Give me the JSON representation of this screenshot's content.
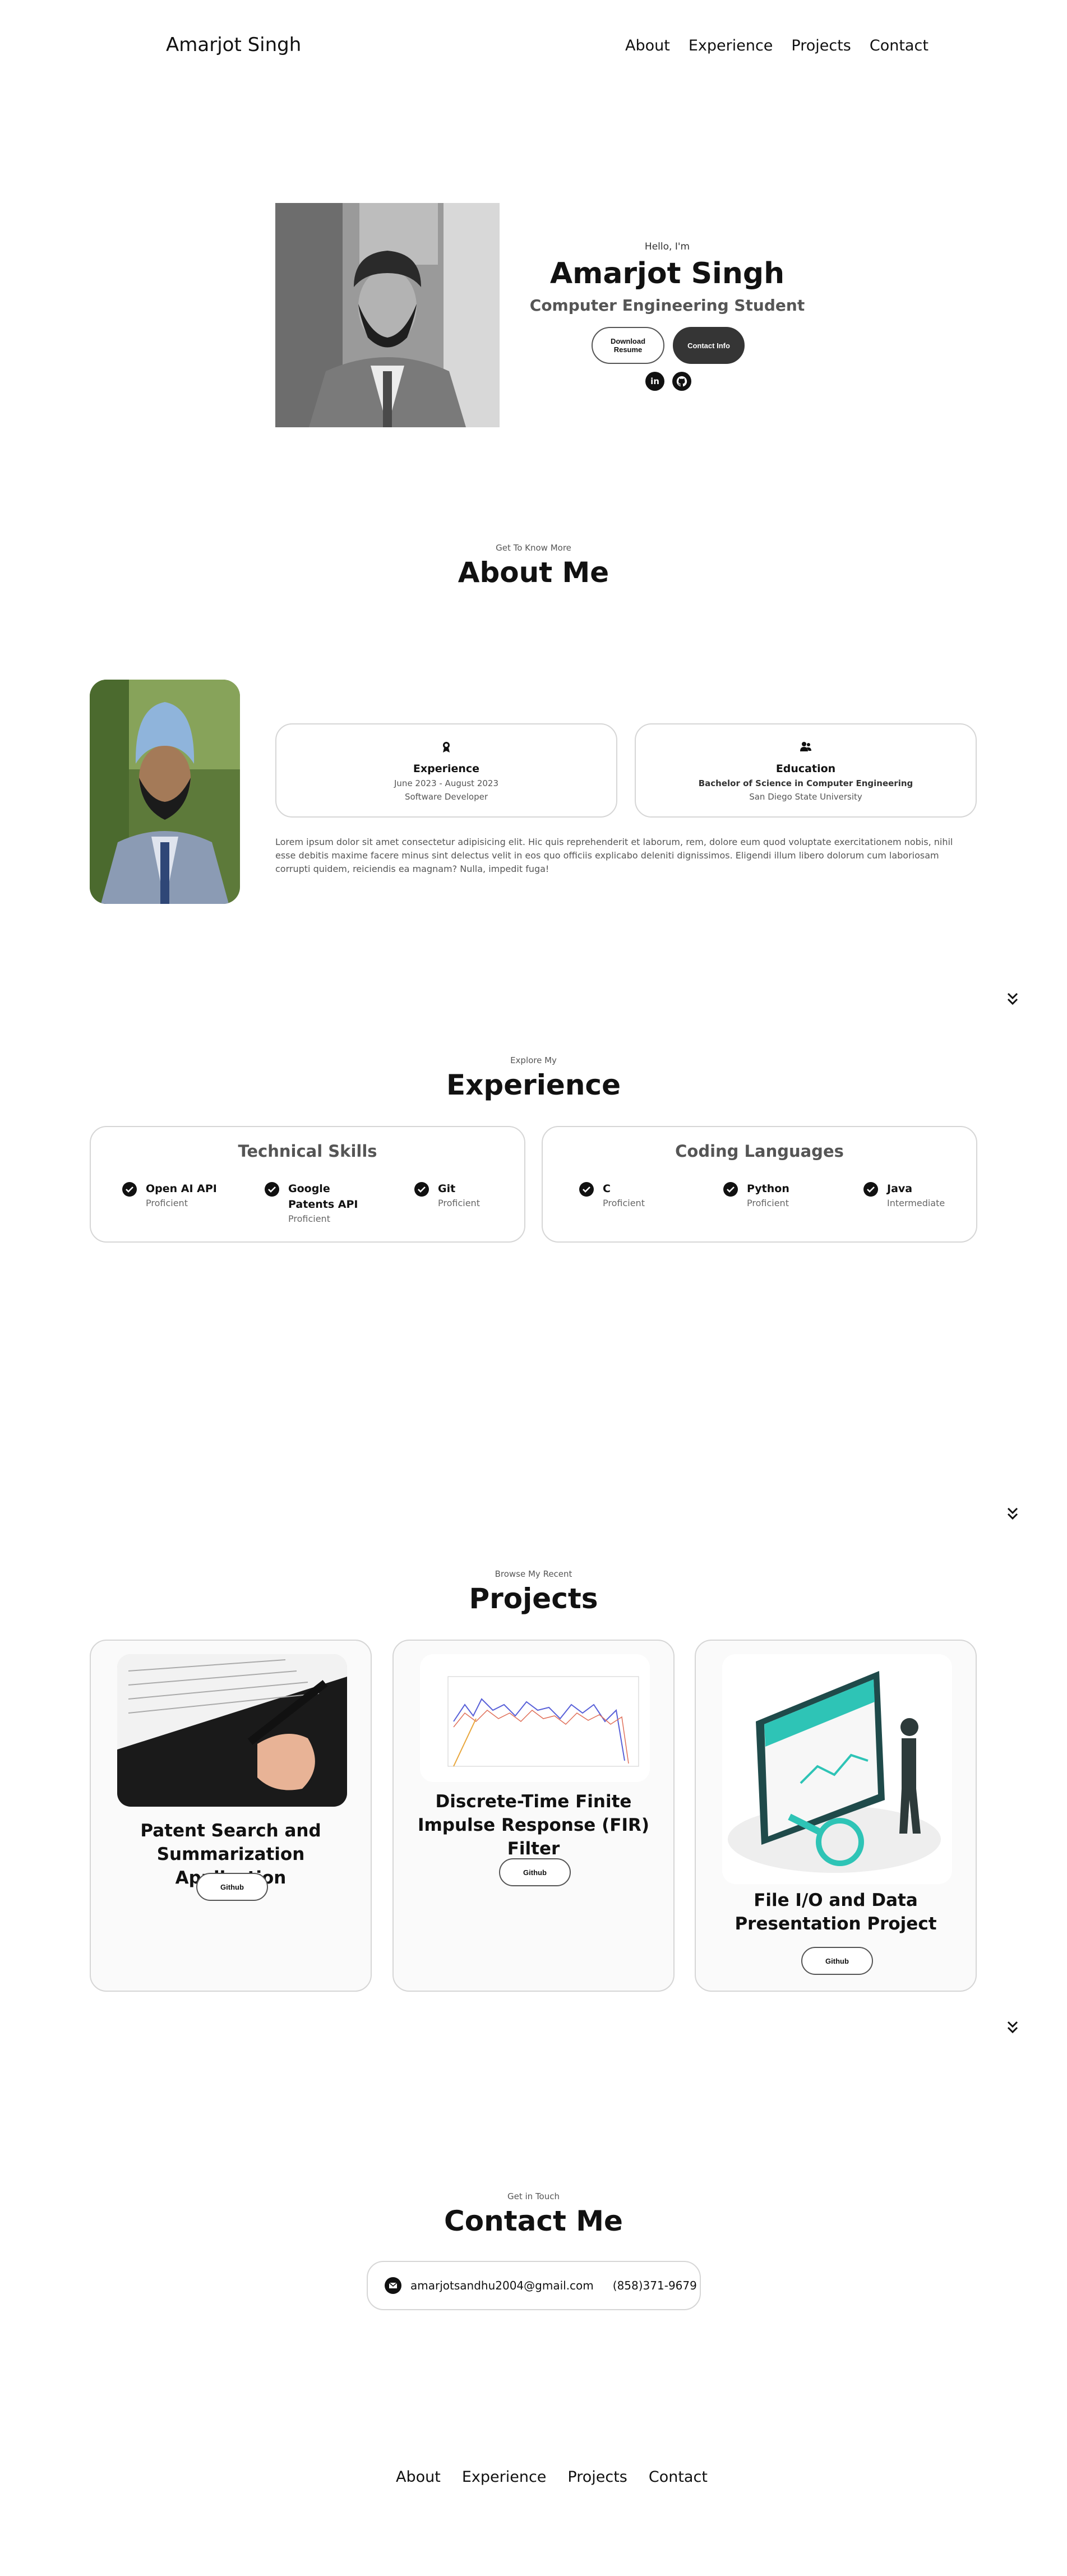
{
  "nav": {
    "logo": "Amarjot Singh",
    "links": [
      "About",
      "Experience",
      "Projects",
      "Contact"
    ]
  },
  "hero": {
    "greeting": "Hello, I'm",
    "name": "Amarjot Singh",
    "title": "Computer Engineering Student",
    "download_label": "Download Resume",
    "contact_label": "Contact Info",
    "social": [
      "linkedin-icon",
      "github-icon"
    ]
  },
  "about": {
    "kicker": "Get To Know More",
    "title": "About Me",
    "experience": {
      "title": "Experience",
      "dates": "June 2023 - August 2023",
      "role": "Software Developer"
    },
    "education": {
      "title": "Education",
      "degree": "Bachelor of Science in Computer Engineering",
      "school": "San Diego State University"
    },
    "bio": "Lorem ipsum dolor sit amet consectetur adipisicing elit. Hic quis reprehenderit et laborum, rem, dolore eum quod voluptate exercitationem nobis, nihil esse debitis maxime facere minus sint delectus velit in eos quo officiis explicabo deleniti dignissimos. Eligendi illum libero dolorum cum laboriosam corrupti quidem, reiciendis ea magnam? Nulla, impedit fuga!"
  },
  "experience": {
    "kicker": "Explore My",
    "title": "Experience",
    "technical": {
      "title": "Technical Skills",
      "items": [
        {
          "name": "Open AI API",
          "level": "Proficient"
        },
        {
          "name": "Google Patents API",
          "level": "Proficient"
        },
        {
          "name": "Git",
          "level": "Proficient"
        }
      ]
    },
    "languages": {
      "title": "Coding Languages",
      "items": [
        {
          "name": "C",
          "level": "Proficient"
        },
        {
          "name": "Python",
          "level": "Proficient"
        },
        {
          "name": "Java",
          "level": "Intermediate"
        }
      ]
    }
  },
  "projects": {
    "kicker": "Browse My Recent",
    "title": "Projects",
    "items": [
      {
        "title": "Patent Search and Summarization Application",
        "button": "Github"
      },
      {
        "title": "Discrete-Time Finite Impulse Response (FIR) Filter",
        "button": "Github"
      },
      {
        "title": "File I/O and Data Presentation Project",
        "button": "Github"
      }
    ]
  },
  "contact": {
    "kicker": "Get in Touch",
    "title": "Contact Me",
    "email": "amarjotsandhu2004@gmail.com",
    "phone": "(858)371-9679"
  },
  "footer": {
    "links": [
      "About",
      "Experience",
      "Projects",
      "Contact"
    ]
  },
  "colors": {
    "dark_button": "#353535",
    "border": "#d6d6d6",
    "muted_text": "#555555"
  }
}
